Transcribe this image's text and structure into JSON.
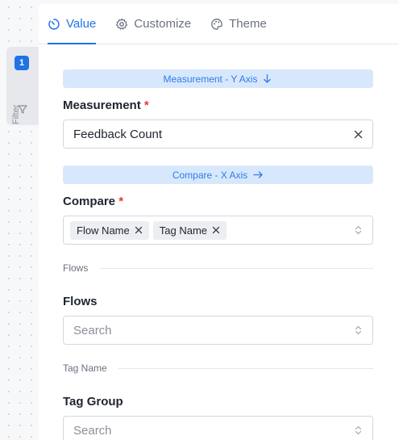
{
  "filter": {
    "badge": "1",
    "label": "Filter",
    "icon": "funnel-icon"
  },
  "tabs": [
    {
      "label": "Value",
      "icon": "value-icon",
      "active": true
    },
    {
      "label": "Customize",
      "icon": "gear-icon",
      "active": false
    },
    {
      "label": "Theme",
      "icon": "palette-icon",
      "active": false
    }
  ],
  "measurement_banner": {
    "label": "Measurement - Y Axis",
    "icon": "arrow-down-icon"
  },
  "measurement": {
    "label": "Measurement",
    "required": "*",
    "value": "Feedback Count"
  },
  "compare_banner": {
    "label": "Compare - X Axis",
    "icon": "arrow-right-icon"
  },
  "compare": {
    "label": "Compare",
    "required": "*",
    "chips": [
      "Flow Name",
      "Tag Name"
    ]
  },
  "flows_section": {
    "title": "Flows"
  },
  "flows": {
    "label": "Flows",
    "placeholder": "Search"
  },
  "tag_section": {
    "title": "Tag Name"
  },
  "tag_group": {
    "label": "Tag Group",
    "placeholder": "Search"
  },
  "colors": {
    "accent": "#1f73e6",
    "banner_bg": "#d8e8fc",
    "required": "#e53935"
  }
}
